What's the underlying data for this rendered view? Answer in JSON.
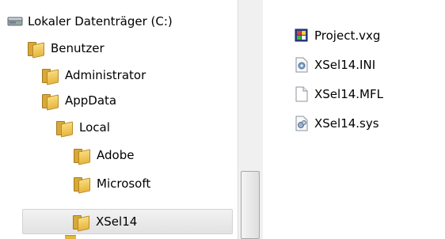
{
  "tree": {
    "drive": {
      "label": "Lokaler Datenträger (C:)",
      "icon": "hard-drive-icon"
    },
    "folders": [
      {
        "label": "Benutzer",
        "icon": "folder-icon"
      },
      {
        "label": "Administrator",
        "icon": "folder-icon"
      },
      {
        "label": "AppData",
        "icon": "folder-icon"
      },
      {
        "label": "Local",
        "icon": "folder-icon"
      },
      {
        "label": "Adobe",
        "icon": "folder-icon"
      },
      {
        "label": "Microsoft",
        "icon": "folder-icon"
      },
      {
        "label": "XSel14",
        "icon": "folder-icon",
        "selected": true
      }
    ]
  },
  "files": [
    {
      "label": "Project.vxg",
      "icon": "project-file-icon"
    },
    {
      "label": "XSel14.INI",
      "icon": "settings-file-icon"
    },
    {
      "label": "XSel14.MFL",
      "icon": "blank-file-icon"
    },
    {
      "label": "XSel14.sys",
      "icon": "system-file-icon"
    }
  ],
  "colors": {
    "folder": "#e6b640",
    "selection": "#e2e2e2",
    "scrollbar": "#f0f0f0"
  }
}
